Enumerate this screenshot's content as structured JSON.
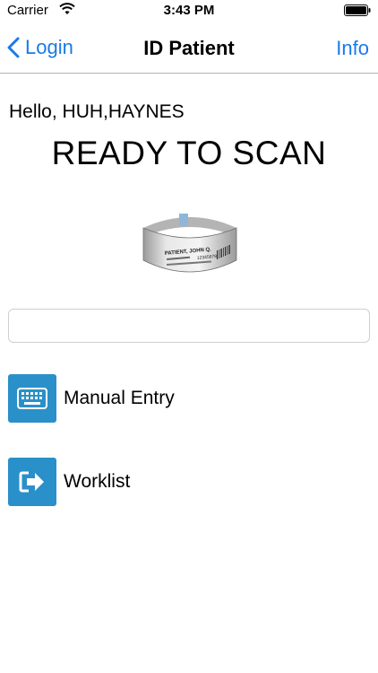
{
  "status_bar": {
    "carrier": "Carrier",
    "time": "3:43 PM"
  },
  "nav": {
    "back_label": "Login",
    "title": "ID Patient",
    "info_label": "Info"
  },
  "content": {
    "greeting": "Hello, HUH,HAYNES",
    "status_heading": "READY TO SCAN",
    "wristband": {
      "name": "PATIENT, JOHN Q.",
      "id": "12345678"
    },
    "scan_input": {
      "value": "",
      "placeholder": ""
    }
  },
  "actions": [
    {
      "label": "Manual Entry",
      "icon": "keyboard-icon"
    },
    {
      "label": "Worklist",
      "icon": "sign-out-arrow-icon"
    }
  ],
  "colors": {
    "accent": "#1a7ae6",
    "action_tile": "#2a90c9"
  }
}
